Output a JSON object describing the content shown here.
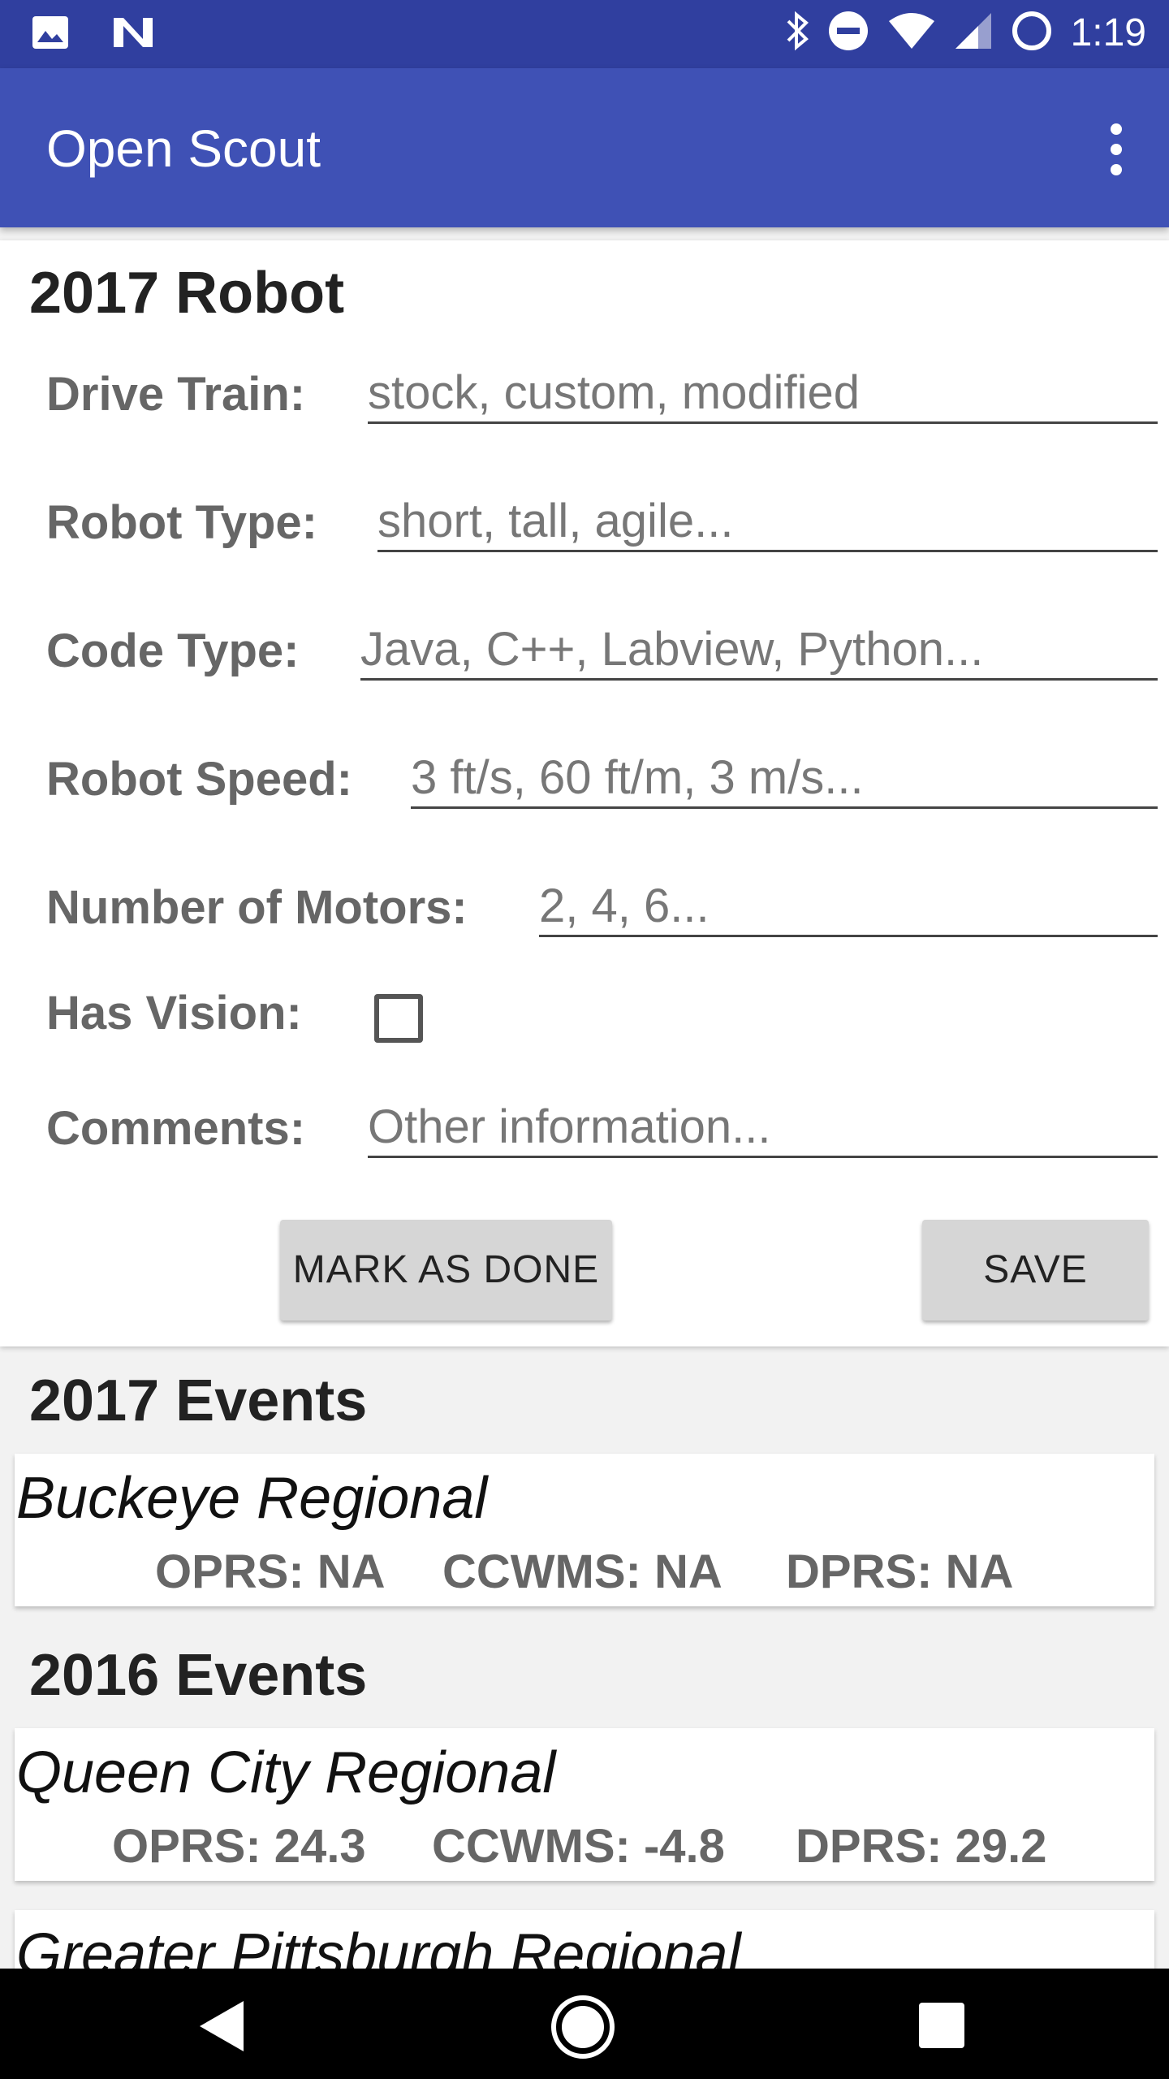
{
  "status_bar": {
    "time": "1:19",
    "left_icons": [
      "image-icon",
      "n-logo-icon"
    ],
    "right_icons": [
      "bluetooth-icon",
      "do-not-disturb-icon",
      "wifi-icon",
      "signal-icon",
      "battery-icon"
    ]
  },
  "app_bar": {
    "title": "Open Scout",
    "overflow_icon": "more-vert-icon"
  },
  "robot": {
    "title": "2017 Robot",
    "fields": [
      {
        "label": "Drive Train:",
        "placeholder": "stock, custom, modified"
      },
      {
        "label": "Robot Type:",
        "placeholder": "short, tall, agile..."
      },
      {
        "label": "Code Type:",
        "placeholder": "Java, C++, Labview, Python..."
      },
      {
        "label": "Robot Speed:",
        "placeholder": "3 ft/s, 60 ft/m, 3 m/s..."
      },
      {
        "label": "Number of Motors:",
        "placeholder": "2, 4, 6..."
      }
    ],
    "vision": {
      "label": "Has Vision:",
      "checked": false
    },
    "comments": {
      "label": "Comments:",
      "placeholder": "Other information..."
    },
    "mark_done_label": "MARK AS DONE",
    "save_label": "SAVE"
  },
  "events_2017": {
    "title": "2017 Events",
    "items": [
      {
        "name": "Buckeye Regional",
        "oprs": "OPRS: NA",
        "ccwms": "CCWMS: NA",
        "dprs": "DPRS: NA"
      }
    ]
  },
  "events_2016": {
    "title": "2016 Events",
    "items": [
      {
        "name": "Queen City Regional",
        "oprs": "OPRS: 24.3",
        "ccwms": "CCWMS: -4.8",
        "dprs": "DPRS: 29.2"
      },
      {
        "name": "Greater Pittsburgh Regional"
      }
    ]
  },
  "nav_bar": {
    "icons": [
      "back-icon",
      "home-icon",
      "recents-icon"
    ]
  },
  "colors": {
    "status_bar": "#303f9f",
    "app_bar": "#3f51b5",
    "button": "#d6d6d6"
  }
}
